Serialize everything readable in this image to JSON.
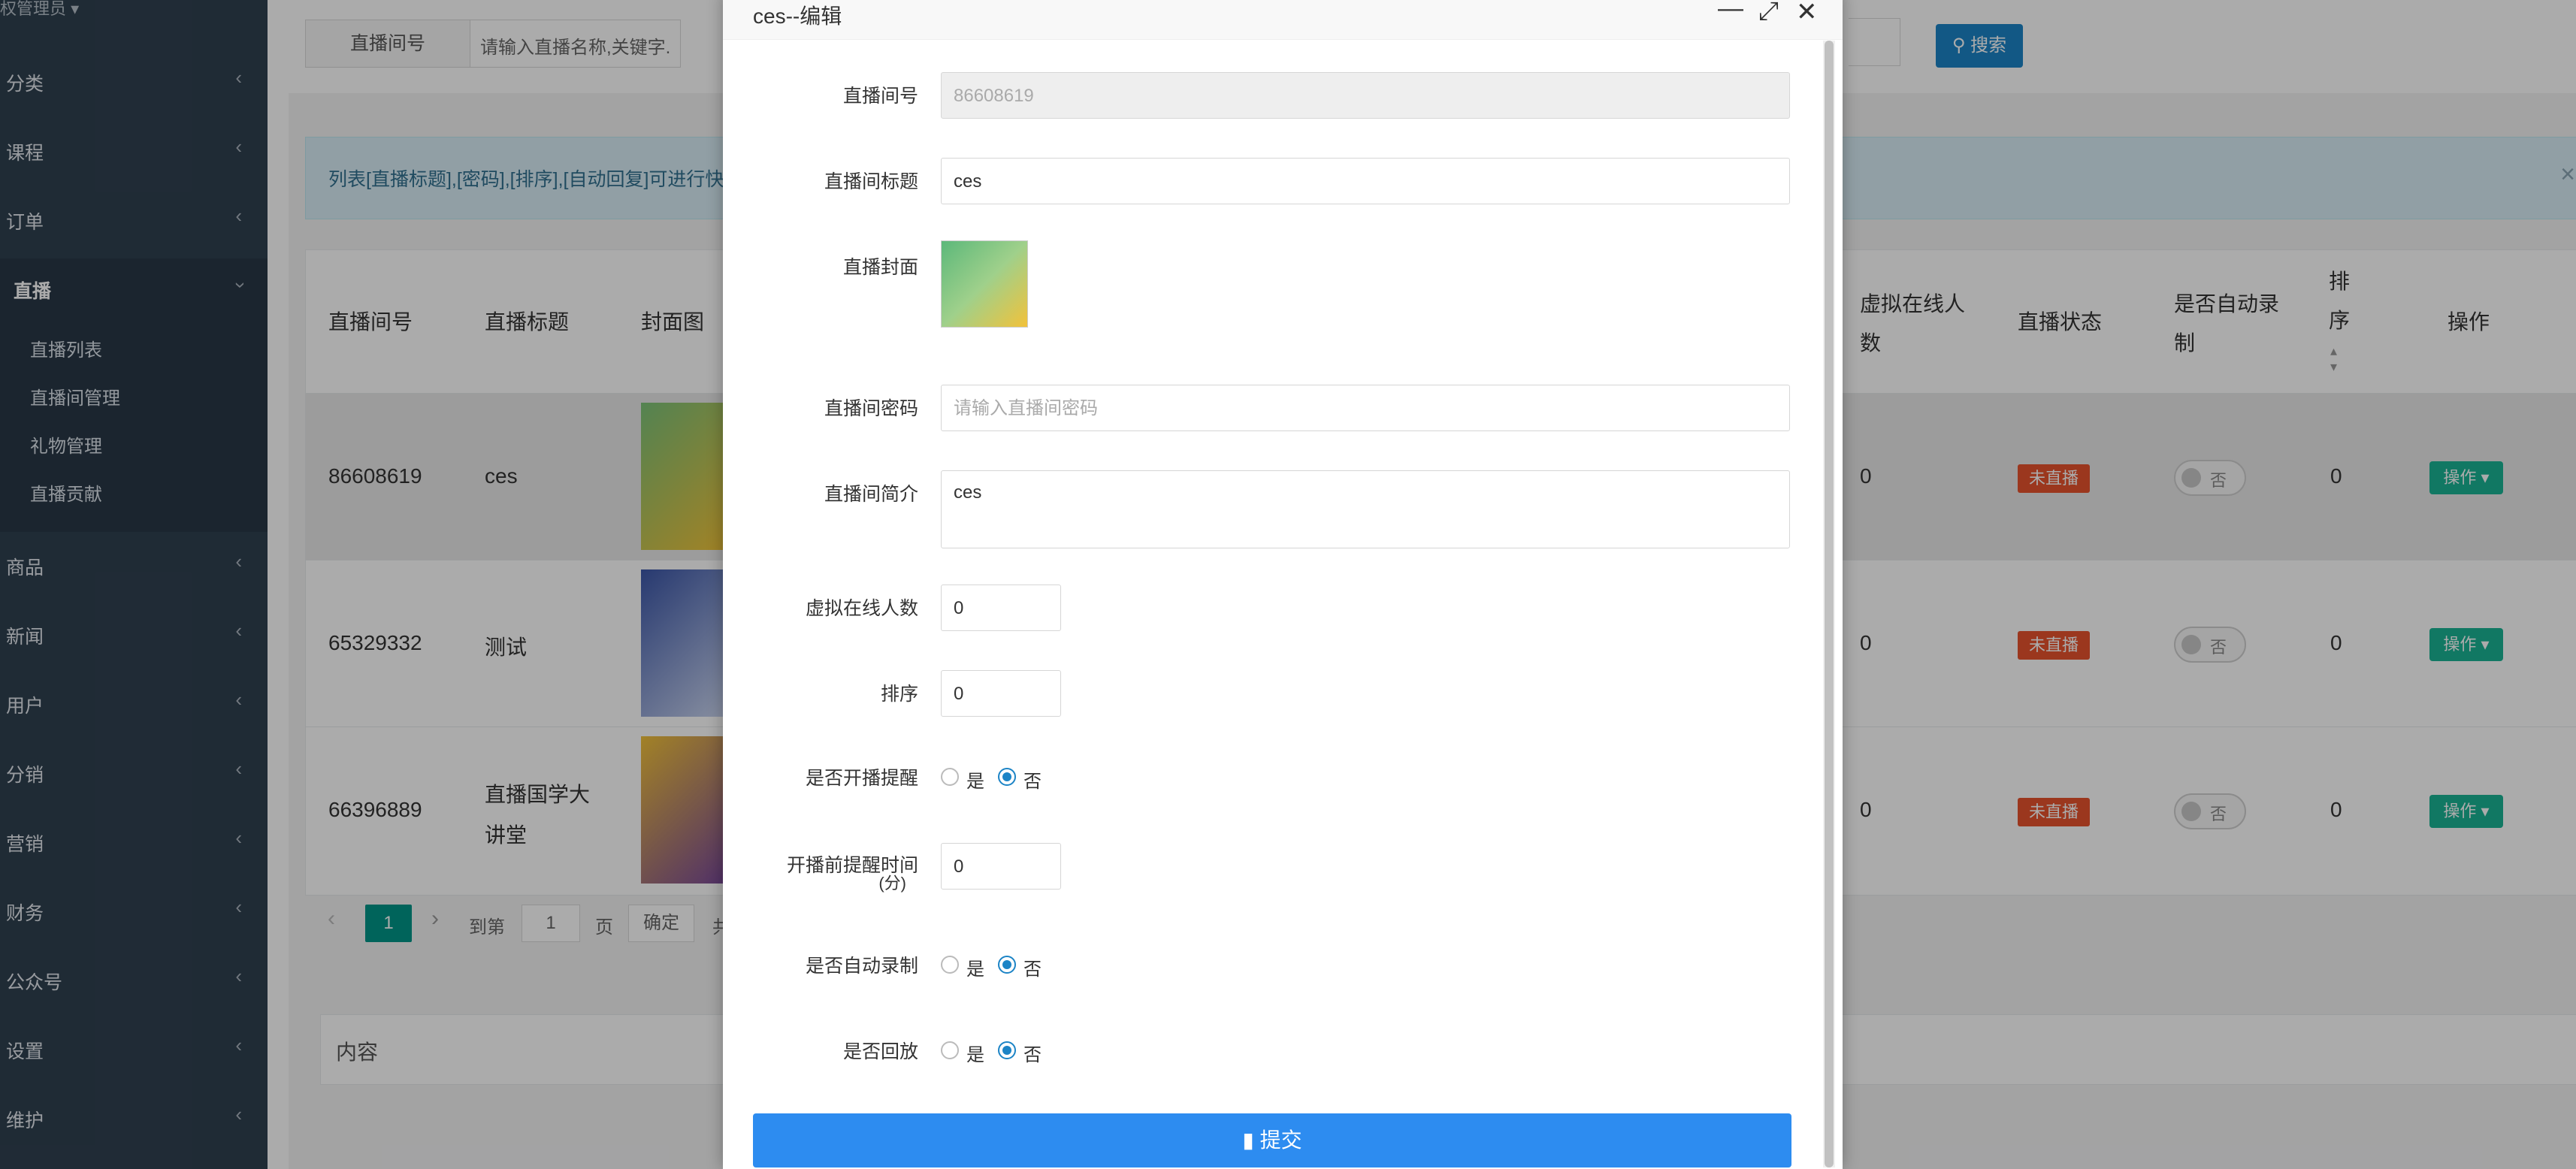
{
  "sidebar": {
    "admin_label": "权管理员",
    "items": [
      {
        "label": "分类"
      },
      {
        "label": "课程"
      },
      {
        "label": "订单"
      },
      {
        "label": "直播"
      },
      {
        "label": "商品"
      },
      {
        "label": "新闻"
      },
      {
        "label": "用户"
      },
      {
        "label": "分销"
      },
      {
        "label": "营销"
      },
      {
        "label": "财务"
      },
      {
        "label": "公众号"
      },
      {
        "label": "设置"
      },
      {
        "label": "维护"
      }
    ],
    "sub_items": [
      {
        "label": "直播列表"
      },
      {
        "label": "直播间管理"
      },
      {
        "label": "礼物管理"
      },
      {
        "label": "直播贡献"
      }
    ]
  },
  "search": {
    "label": "直播间号",
    "placeholder": "请输入直播名称,关键字.",
    "button": "搜索"
  },
  "notice": {
    "text": "列表[直播标题],[密码],[排序],[自动回复]可进行快"
  },
  "table": {
    "headers": {
      "room_no": "直播间号",
      "title": "直播标题",
      "cover": "封面图",
      "virtual_online_1": "虚拟在线人",
      "virtual_online_2": "数",
      "status": "直播状态",
      "auto_record_1": "是否自动录",
      "auto_record_2": "制",
      "sort_1": "排",
      "sort_2": "序",
      "ops": "操作"
    },
    "rows": [
      {
        "room_no": "86608619",
        "title_1": "ces",
        "title_2": "",
        "virtual": "0",
        "status": "未直播",
        "auto_record": "否",
        "sort": "0",
        "op": "操作"
      },
      {
        "room_no": "65329332",
        "title_1": "测试",
        "title_2": "",
        "virtual": "0",
        "status": "未直播",
        "auto_record": "否",
        "sort": "0",
        "op": "操作"
      },
      {
        "room_no": "66396889",
        "title_1": "直播国学大",
        "title_2": "讲堂",
        "virtual": "0",
        "status": "未直播",
        "auto_record": "否",
        "sort": "0",
        "op": "操作"
      }
    ]
  },
  "pager": {
    "current": "1",
    "goto": "到第",
    "page_value": "1",
    "page": "页",
    "confirm": "确定",
    "total_prefix": "共"
  },
  "content_panel": {
    "label": "内容"
  },
  "modal": {
    "title": "ces--编辑",
    "fields": {
      "room_no_label": "直播间号",
      "room_no_value": "86608619",
      "title_label": "直播间标题",
      "title_value": "ces",
      "cover_label": "直播封面",
      "password_label": "直播间密码",
      "password_placeholder": "请输入直播间密码",
      "intro_label": "直播间简介",
      "intro_value": "ces",
      "virtual_label": "虚拟在线人数",
      "virtual_value": "0",
      "sort_label": "排序",
      "sort_value": "0",
      "remind_label": "是否开播提醒",
      "remind_time_label_1": "开播前提醒时间",
      "remind_time_label_2": "(分)",
      "remind_time_value": "0",
      "auto_record_label": "是否自动录制",
      "playback_label": "是否回放",
      "yes": "是",
      "no": "否"
    },
    "submit": "提交"
  },
  "colors": {
    "sidebar_bg": "#2f4050",
    "primary": "#1c84c6",
    "teal": "#1ab394",
    "danger": "#e8532e",
    "submit": "#2d8cf0"
  }
}
